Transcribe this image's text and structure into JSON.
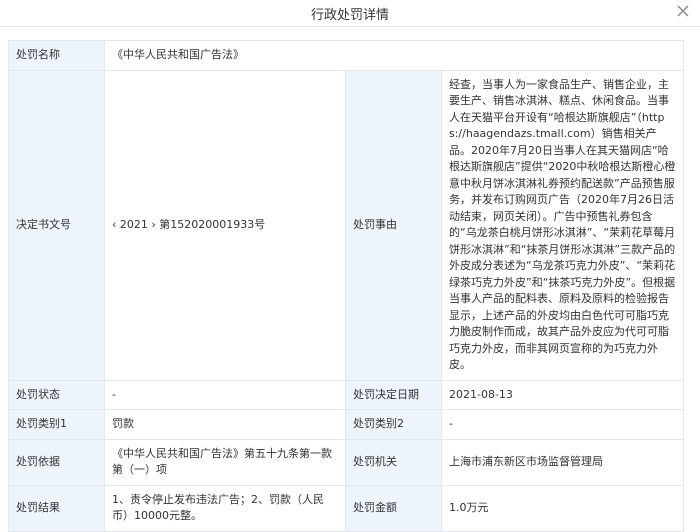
{
  "dialog": {
    "title": "行政处罚详情",
    "close_icon": "close-icon"
  },
  "labels": {
    "penalty_name": "处罚名称",
    "decision_no": "决定书文号",
    "penalty_reason": "处罚事由",
    "penalty_status": "处罚状态",
    "decision_date": "处罚决定日期",
    "category1": "处罚类别1",
    "category2": "处罚类别2",
    "basis": "处罚依据",
    "authority": "处罚机关",
    "result": "处罚结果",
    "amount": "处罚金额"
  },
  "values": {
    "penalty_name": "《中华人民共和国广告法》",
    "decision_no": "‹ 2021 › 第152020001933号",
    "penalty_reason": "经查，当事人为一家食品生产、销售企业，主要生产、销售冰淇淋、糕点、休闲食品。当事人在天猫平台开设有“哈根达斯旗舰店”（https://haagendazs.tmall.com）销售相关产品。2020年7月20日当事人在其天猫网店“哈根达斯旗舰店”提供“2020中秋哈根达斯橙心橙意中秋月饼冰淇淋礼券预约配送款”产品预售服务，并发布订购网页广告（2020年7月26日活动结束，网页关闭）。广告中预售礼券包含的“乌龙茶白桃月饼形冰淇淋”、“茉莉花草莓月饼形冰淇淋”和“抹茶月饼形冰淇淋”三款产品的外皮成分表述为“乌龙茶巧克力外皮”、“茉莉花绿茶巧克力外皮”和“抹茶巧克力外皮”。但根据当事人产品的配料表、原料及原料的检验报告显示，上述产品的外皮均由白色代可可脂巧克力脆皮制作而成，故其产品外皮应为代可可脂巧克力外皮，而非其网页宣称的为巧克力外皮。",
    "penalty_status": "-",
    "decision_date": "2021-08-13",
    "category1": "罚款",
    "category2": "-",
    "basis": "《中华人民共和国广告法》第五十九条第一款第（一）项",
    "authority": "上海市浦东新区市场监督管理局",
    "result": "1、责令停止发布违法广告；2、罚款（人民币）10000元整。",
    "amount": "1.0万元"
  },
  "colors": {
    "label_bg": "#eef4fb",
    "border": "#e4e7ed",
    "text": "#333333"
  }
}
